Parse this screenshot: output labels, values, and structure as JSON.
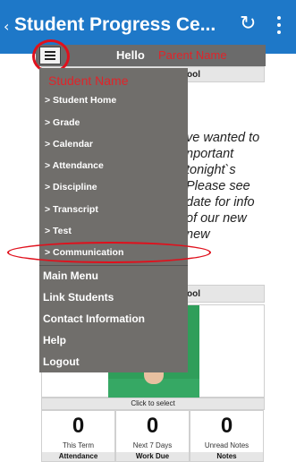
{
  "app_bar": {
    "back_glyph": "‹",
    "title": "Student Progress Ce...",
    "refresh_icon": "refresh-icon",
    "more_icon": "more-vert-icon"
  },
  "hello_bar": {
    "hello": "Hello",
    "parent_name": "Parent Name"
  },
  "drawer": {
    "student_name": "Student Name",
    "student_items": [
      "> Student Home",
      "> Grade",
      "> Calendar",
      "> Attendance",
      "> Discipline",
      "> Transcript",
      "> Test",
      "> Communication"
    ],
    "main_items": [
      "Main Menu",
      "Link Students",
      "Contact Information",
      "Help",
      "Logout"
    ]
  },
  "background": {
    "school_top": "ool",
    "message_lines": [
      "ve wanted to",
      "nportant",
      "tonight`s",
      "Please see",
      "date for info",
      "of our new",
      "new"
    ],
    "school_bottom": "ool",
    "click_to_select": "Click to select"
  },
  "stats": [
    {
      "value": "0",
      "label": "This Term",
      "footer": "Attendance"
    },
    {
      "value": "0",
      "label": "Next 7 Days",
      "footer": "Work Due"
    },
    {
      "value": "0",
      "label": "Unread Notes",
      "footer": "Notes"
    }
  ],
  "colors": {
    "app_bar": "#1e78c8",
    "drawer": "#706e6b",
    "annotation": "#e0101c"
  }
}
